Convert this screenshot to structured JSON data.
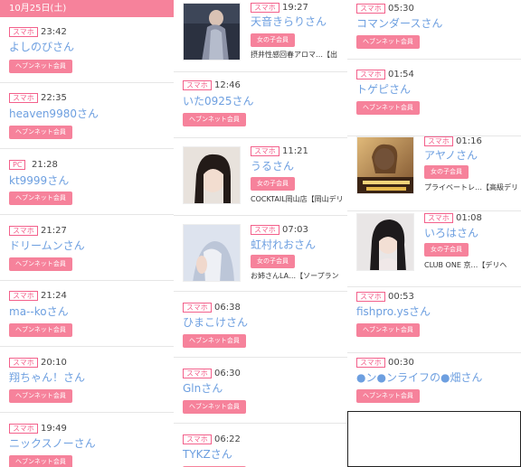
{
  "date_header": "10月25日(土)",
  "col1": [
    {
      "badge": "スマホ",
      "time": "23:42",
      "name": "よしのびさん",
      "role": "ヘブンネット会員"
    },
    {
      "badge": "スマホ",
      "time": "22:35",
      "name": "heaven9980さん",
      "role": "ヘブンネット会員"
    },
    {
      "badge": "PC",
      "time": "21:28",
      "name": "kt9999さん",
      "role": "ヘブンネット会員"
    },
    {
      "badge": "スマホ",
      "time": "21:27",
      "name": "ドリームンさん",
      "role": "ヘブンネット会員"
    },
    {
      "badge": "スマホ",
      "time": "21:24",
      "name": "ma--koさん",
      "role": "ヘブンネット会員"
    },
    {
      "badge": "スマホ",
      "time": "20:10",
      "name": "翔ちゃん！さん",
      "role": "ヘブンネット会員"
    },
    {
      "badge": "スマホ",
      "time": "19:49",
      "name": "ニックスノーさん",
      "role": "ヘブンネット会員"
    }
  ],
  "col2": [
    {
      "badge": "スマホ",
      "time": "19:27",
      "name": "天音きらりさん",
      "role": "女の子会員",
      "shop": "摂井性感回春アロマ…【出"
    },
    {
      "badge": "スマホ",
      "time": "12:46",
      "name": "いた0925さん",
      "role": "ヘブンネット会員"
    },
    {
      "badge": "スマホ",
      "time": "11:21",
      "name": "うるさん",
      "role": "女の子会員",
      "shop": "COCKTAIL岡山店【岡山デリ"
    },
    {
      "badge": "スマホ",
      "time": "07:03",
      "name": "虹村れおさん",
      "role": "女の子会員",
      "shop": "お姉さんLA…【ソープラン"
    },
    {
      "badge": "スマホ",
      "time": "06:38",
      "name": "ひまこけさん",
      "role": "ヘブンネット会員"
    },
    {
      "badge": "スマホ",
      "time": "06:30",
      "name": "Glnさん",
      "role": "ヘブンネット会員"
    },
    {
      "badge": "スマホ",
      "time": "06:22",
      "name": "TYKZさん",
      "role": "ヘブンネット会員"
    }
  ],
  "col3": [
    {
      "badge": "スマホ",
      "time": "05:30",
      "name": "コマンダースさん",
      "role": "ヘブンネット会員"
    },
    {
      "badge": "スマホ",
      "time": "01:54",
      "name": "トゲピさん",
      "role": "ヘブンネット会員"
    },
    {
      "badge": "スマホ",
      "time": "01:16",
      "name": "アヤノさん",
      "role": "女の子会員",
      "shop": "プライベートレ…【高級デリ"
    },
    {
      "badge": "スマホ",
      "time": "01:08",
      "name": "いろはさん",
      "role": "女の子会員",
      "shop": "CLUB ONE 京…【デリヘ"
    },
    {
      "badge": "スマホ",
      "time": "00:53",
      "name": "fishpro.ysさん",
      "role": "ヘブンネット会員"
    },
    {
      "badge": "スマホ",
      "time": "00:30",
      "name": "●ン●ンライフの●畑さん",
      "role": "ヘブンネット会員"
    }
  ],
  "colors": {
    "accent": "#f6829b",
    "badge_border": "#f3608b",
    "name_link": "#6d9fe0"
  }
}
